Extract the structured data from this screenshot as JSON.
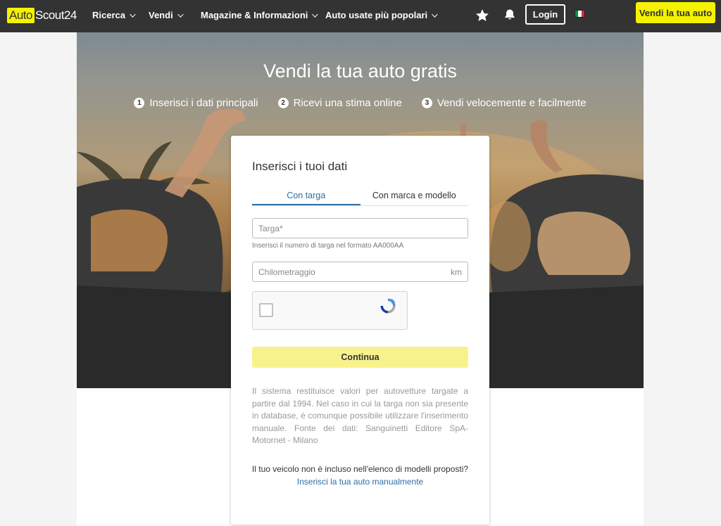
{
  "nav": {
    "logo_part1": "Auto",
    "logo_part2": "Scout24",
    "items": [
      {
        "label": "Ricerca"
      },
      {
        "label": "Vendi"
      },
      {
        "label": "Magazine & Informazioni"
      },
      {
        "label": "Auto usate più popolari"
      }
    ],
    "favorites_icon": "star-icon",
    "notifications_icon": "bell-icon",
    "login_label": "Login",
    "language_flag": "italy-flag",
    "sell_button": "Vendi la tua auto",
    "brand_color": "#f5f200"
  },
  "hero": {
    "title": "Vendi la tua auto gratis",
    "steps": [
      {
        "num": "1",
        "label": "Inserisci i dati principali"
      },
      {
        "num": "2",
        "label": "Ricevi una stima online"
      },
      {
        "num": "3",
        "label": "Vendi velocemente e facilmente"
      }
    ]
  },
  "form": {
    "title": "Inserisci i tuoi dati",
    "tabs": [
      {
        "label": "Con targa",
        "active": true
      },
      {
        "label": "Con marca e modello",
        "active": false
      }
    ],
    "plate_placeholder": "Targa*",
    "plate_hint": "Inserisci il numero di targa nel formato AA000AA",
    "mileage_placeholder": "Chilometraggio",
    "mileage_unit": "km",
    "captcha_icon": "recaptcha-icon",
    "continue_label": "Continua",
    "disclaimer": "Il sistema restituisce valori per autovetture targate a partire dal 1994. Nel caso in cui la targa non sia presente in database, è comunque possibile utilizzare l'inserimento manuale. Fonte dei dati: Sanguinetti Editore SpA-Motornet - Milano",
    "question": "Il tuo veicolo non è incluso nell'elenco di modelli proposti?",
    "manual_link": "Inserisci la tua auto manualmente",
    "accent_color": "#2e6ea6"
  }
}
